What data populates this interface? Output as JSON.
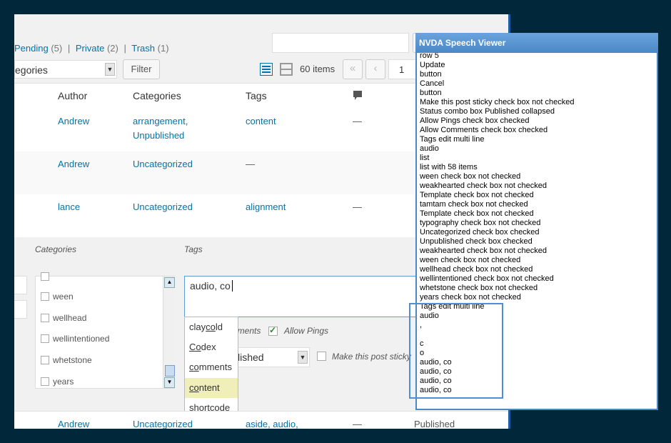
{
  "status_links": [
    {
      "label": "Pending",
      "count": "(5)"
    },
    {
      "label": "Private",
      "count": "(2)"
    },
    {
      "label": "Trash",
      "count": "(1)"
    }
  ],
  "separator": "|",
  "category_dropdown": "egories",
  "filter_button": "Filter",
  "items_count": "60 items",
  "pagination": {
    "first": "«",
    "prev": "‹",
    "page": "1"
  },
  "table_headers": {
    "author": "Author",
    "categories": "Categories",
    "tags": "Tags"
  },
  "rows": [
    {
      "author": "Andrew",
      "cat1": "arrangement,",
      "cat2": "Unpublished",
      "tags": "content",
      "comments": "—"
    },
    {
      "author": "Andrew",
      "cat1": "Uncategorized",
      "cat2": "",
      "tags": "—",
      "comments": ""
    },
    {
      "author": "lance",
      "cat1": "Uncategorized",
      "cat2": "",
      "tags": "alignment",
      "comments": "—"
    }
  ],
  "quick_edit": {
    "categories_label": "Categories",
    "tags_label": "Tags",
    "tags_value": "audio, co",
    "categories": [
      "ween",
      "wellhead",
      "wellintentioned",
      "whetstone",
      "years"
    ],
    "comments_fragment": "nments",
    "allow_pings": "Allow Pings",
    "status_fragment": "lished",
    "sticky_label": "Make this post sticky"
  },
  "suggestions": [
    {
      "pre": "clay",
      "hl": "co",
      "post": "ld"
    },
    {
      "pre": "",
      "hl": "Co",
      "post": "dex"
    },
    {
      "pre": "",
      "hl": "co",
      "post": "mments"
    },
    {
      "pre": "",
      "hl": "co",
      "post": "ntent"
    },
    {
      "pre": "short",
      "hl": "co",
      "post": "de"
    }
  ],
  "bottom_row": {
    "author": "Andrew",
    "cat": "Uncategorized",
    "tags": "aside, audio,",
    "comments": "—",
    "status": "Published"
  },
  "nvda": {
    "title": "NVDA Speech Viewer",
    "lines": [
      "row 5",
      "Update",
      "button",
      "Cancel",
      "button",
      "Make this post sticky  check box  not checked",
      "Status  combo box  Published  collapsed",
      "Allow Pings  check box  checked",
      "Allow Comments  check box  checked",
      "Tags  edit  multi line",
      "audio",
      "list",
      "list with 58 items",
      "ween  check box  not checked",
      "weakhearted  check box  not checked",
      "Template  check box  not checked",
      "tamtam  check box  not checked",
      "Template  check box  not checked",
      "typography  check box  not checked",
      "Uncategorized  check box  checked",
      "Unpublished  check box  checked",
      "weakhearted  check box  not checked",
      "ween  check box  not checked",
      "wellhead  check box  not checked",
      "wellintentioned  check box  not checked",
      "whetstone  check box  not checked",
      "years  check box  not checked",
      "Tags  edit  multi line",
      "audio",
      ",",
      "",
      "c",
      "o",
      "audio, co",
      "audio, co",
      "audio, co",
      "audio, co"
    ]
  },
  "colors": {
    "link": "#0073aa",
    "highlight_box": "#4a90d9",
    "nvda_frame": "#4a88c6"
  }
}
